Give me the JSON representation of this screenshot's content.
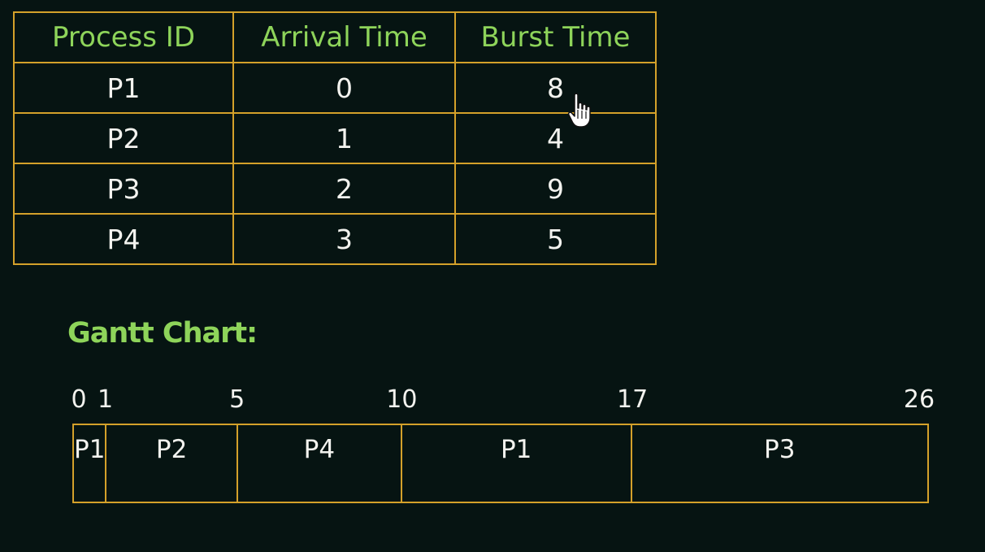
{
  "table": {
    "headers": [
      "Process ID",
      "Arrival Time",
      "Burst Time"
    ],
    "rows": [
      {
        "pid": "P1",
        "arrival": "0",
        "burst": "8"
      },
      {
        "pid": "P2",
        "arrival": "1",
        "burst": "4"
      },
      {
        "pid": "P3",
        "arrival": "2",
        "burst": "9"
      },
      {
        "pid": "P4",
        "arrival": "3",
        "burst": "5"
      }
    ]
  },
  "gantt": {
    "title": "Gantt Chart:",
    "ticks": [
      "0",
      "1",
      "5",
      "10",
      "17",
      "26"
    ],
    "segments": [
      {
        "label": "P1",
        "start": 0,
        "end": 1
      },
      {
        "label": "P2",
        "start": 1,
        "end": 5
      },
      {
        "label": "P4",
        "start": 5,
        "end": 10
      },
      {
        "label": "P1",
        "start": 10,
        "end": 17
      },
      {
        "label": "P3",
        "start": 17,
        "end": 26
      }
    ]
  },
  "colors": {
    "background": "#061412",
    "header_text": "#8ed45a",
    "border": "#d4a12a",
    "text": "#f3f3ef"
  },
  "cursor": {
    "icon": "hand-pointer-icon"
  }
}
